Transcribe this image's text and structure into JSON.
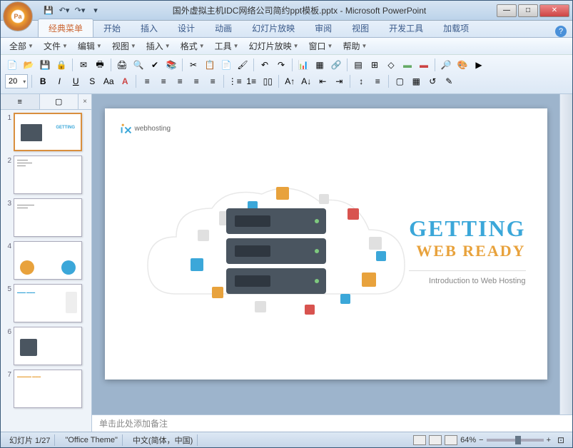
{
  "titlebar": {
    "filename": "国外虚拟主机IDC网络公司简约ppt模板.pptx",
    "app": "Microsoft PowerPoint"
  },
  "ribbon_tabs": [
    "经典菜单",
    "开始",
    "插入",
    "设计",
    "动画",
    "幻灯片放映",
    "审阅",
    "视图",
    "开发工具",
    "加载项"
  ],
  "active_tab": 0,
  "menubar": [
    "全部",
    "文件",
    "编辑",
    "视图",
    "插入",
    "格式",
    "工具",
    "幻灯片放映",
    "窗口",
    "帮助"
  ],
  "font_size": "20",
  "panel_tabs": {
    "outline": "",
    "slides": ""
  },
  "slide": {
    "logo_brand": "webhosting",
    "title_line1": "GETTING",
    "title_line2": "WEB READY",
    "subtitle": "Introduction to Web Hosting"
  },
  "thumbnails": [
    1,
    2,
    3,
    4,
    5,
    6,
    7
  ],
  "selected_thumb": 1,
  "notes_placeholder": "单击此处添加备注",
  "statusbar": {
    "slide_indicator": "幻灯片 1/27",
    "theme": "\"Office Theme\"",
    "language": "中文(简体，中国)",
    "zoom": "64%"
  }
}
